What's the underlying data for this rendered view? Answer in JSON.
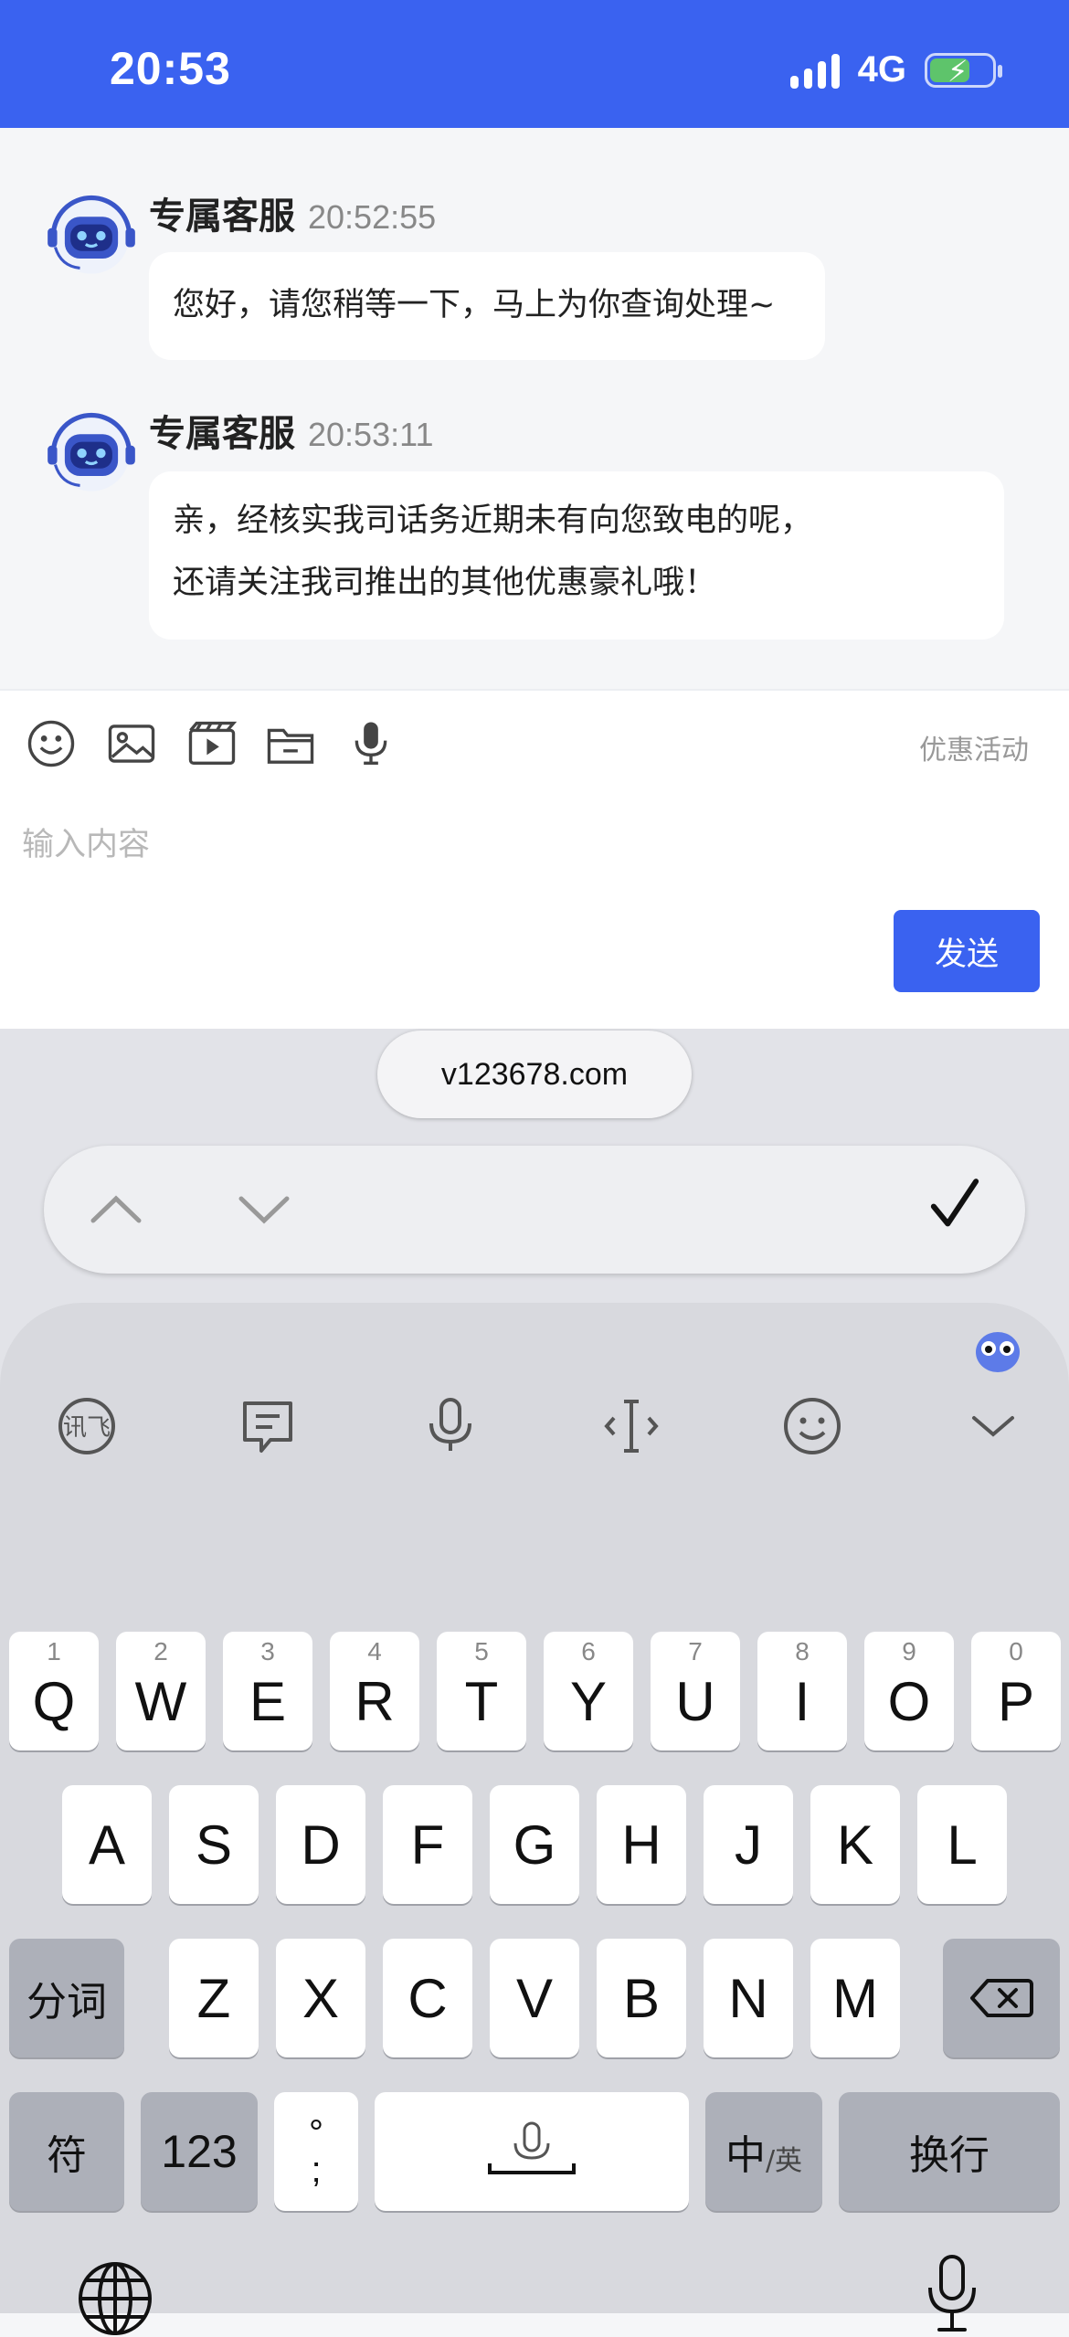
{
  "status_bar": {
    "time": "20:53",
    "network": "4G"
  },
  "messages": [
    {
      "sender": "专属客服",
      "time": "20:52:55",
      "lines": [
        "您好，请您稍等一下，马上为你查询处理~"
      ]
    },
    {
      "sender": "专属客服",
      "time": "20:53:11",
      "lines": [
        "亲，经核实我司话务近期未有向您致电的呢，",
        "还请关注我司推出的其他优惠豪礼哦！"
      ]
    }
  ],
  "composer": {
    "promo_label": "优惠活动",
    "placeholder": "输入内容",
    "send_label": "发送",
    "tools": [
      "emoji-icon",
      "image-icon",
      "video-icon",
      "folder-icon",
      "microphone-icon"
    ]
  },
  "autofill": {
    "url": "v123678.com"
  },
  "keyboard": {
    "toolbar": [
      "iflytek-logo-icon",
      "quick-phrase-icon",
      "voice-icon",
      "cursor-icon",
      "emoji-icon",
      "collapse-icon"
    ],
    "row1": [
      {
        "letter": "Q",
        "num": "1"
      },
      {
        "letter": "W",
        "num": "2"
      },
      {
        "letter": "E",
        "num": "3"
      },
      {
        "letter": "R",
        "num": "4"
      },
      {
        "letter": "T",
        "num": "5"
      },
      {
        "letter": "Y",
        "num": "6"
      },
      {
        "letter": "U",
        "num": "7"
      },
      {
        "letter": "I",
        "num": "8"
      },
      {
        "letter": "O",
        "num": "9"
      },
      {
        "letter": "P",
        "num": "0"
      }
    ],
    "row2": [
      "A",
      "S",
      "D",
      "F",
      "G",
      "H",
      "J",
      "K",
      "L"
    ],
    "row3": [
      "Z",
      "X",
      "C",
      "V",
      "B",
      "N",
      "M"
    ],
    "segment_label": "分词",
    "symbol_label": "符",
    "numeric_label": "123",
    "punct_label": "°\n;",
    "lang_label_main": "中",
    "lang_label_sub": "/英",
    "return_label": "换行"
  },
  "colors": {
    "brand": "#3a62f0",
    "chat_bg": "#f5f6f8",
    "keyboard_bg": "#d8d9de"
  }
}
